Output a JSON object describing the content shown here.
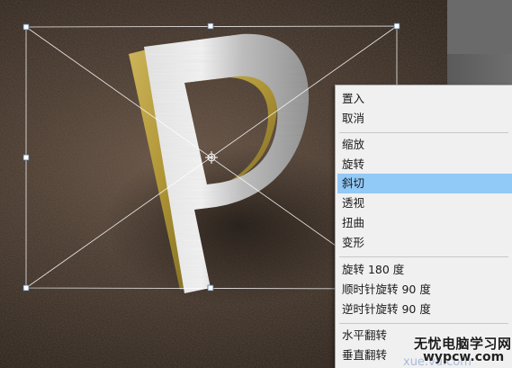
{
  "context_menu": {
    "items": [
      {
        "label": "置入"
      },
      {
        "label": "取消"
      },
      {
        "label": "缩放"
      },
      {
        "label": "旋转"
      },
      {
        "label": "斜切",
        "highlighted": true
      },
      {
        "label": "透视"
      },
      {
        "label": "扭曲"
      },
      {
        "label": "变形"
      },
      {
        "label": "旋转 180 度"
      },
      {
        "label": "顺时针旋转 90 度"
      },
      {
        "label": "逆时针旋转 90 度"
      },
      {
        "label": "水平翻转"
      },
      {
        "label": "垂直翻转"
      }
    ]
  },
  "canvas": {
    "layer_content": "3d-letter-P",
    "letter": "P",
    "colors": {
      "background": "#4a3b30",
      "letter_face": "#c8c8c8",
      "letter_side": "#b8a24a",
      "highlight": "#91c9f7"
    }
  },
  "watermark": {
    "text": "无忧电脑学习网",
    "url": "wypcw.com",
    "url_ghost": "xue.vu.com"
  }
}
